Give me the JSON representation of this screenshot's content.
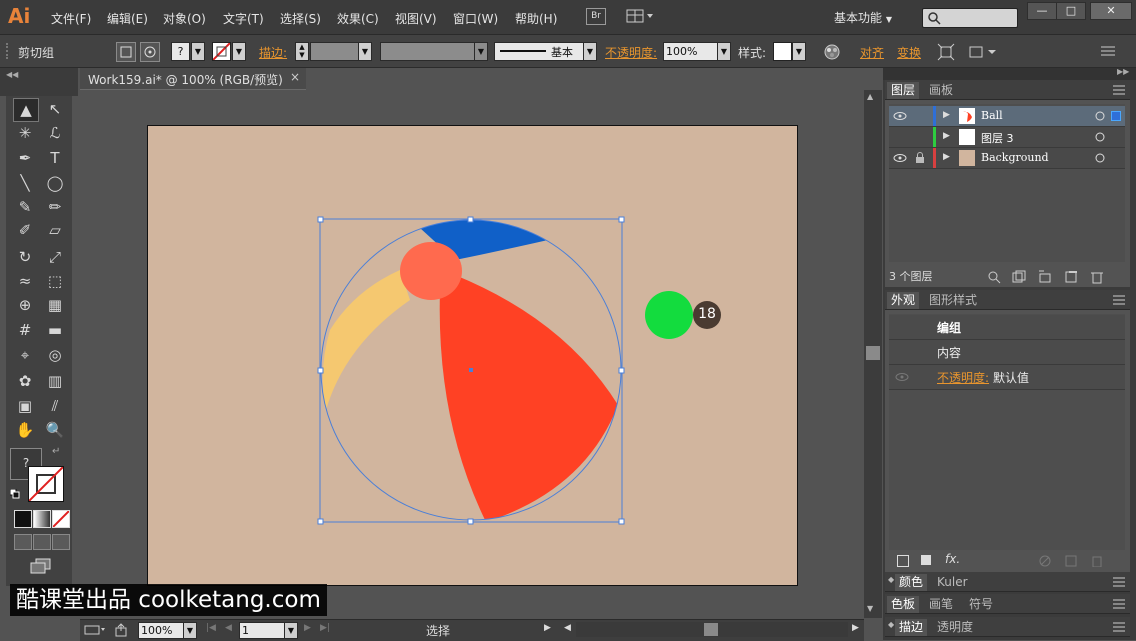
{
  "app": {
    "logo": "Ai",
    "workspace": "基本功能",
    "bridge": "Br"
  },
  "menu": [
    "文件(F)",
    "编辑(E)",
    "对象(O)",
    "文字(T)",
    "选择(S)",
    "效果(C)",
    "视图(V)",
    "窗口(W)",
    "帮助(H)"
  ],
  "window_buttons": [
    "—",
    "□",
    "✕"
  ],
  "control_bar": {
    "selection_label": "剪切组",
    "fill_state": "?",
    "stroke_label": "描边:",
    "stroke_profile": "基本",
    "opacity_label": "不透明度:",
    "opacity_value": "100%",
    "style_label": "样式:",
    "align_label": "对齐",
    "transform_label": "变换"
  },
  "document": {
    "tab_title": "Work159.ai* @ 100% (RGB/预览)",
    "close": "×"
  },
  "tools": [
    [
      "selection-tool",
      "▲"
    ],
    [
      "direct-selection-tool",
      "↖"
    ],
    [
      "magic-wand-tool",
      "✳"
    ],
    [
      "lasso-tool",
      "ℒ"
    ],
    [
      "pen-tool",
      "✒"
    ],
    [
      "type-tool",
      "T"
    ],
    [
      "line-tool",
      "╲"
    ],
    [
      "ellipse-tool",
      "◯"
    ],
    [
      "paintbrush-tool",
      "✎"
    ],
    [
      "pencil-tool",
      "✏"
    ],
    [
      "blob-brush-tool",
      "✐"
    ],
    [
      "eraser-tool",
      "▱"
    ],
    [
      "rotate-tool",
      "↻"
    ],
    [
      "scale-tool",
      "⤢"
    ],
    [
      "warp-tool",
      "≈"
    ],
    [
      "free-transform-tool",
      "⬚"
    ],
    [
      "shape-builder-tool",
      "⊕"
    ],
    [
      "perspective-grid-tool",
      "▦"
    ],
    [
      "mesh-tool",
      "#"
    ],
    [
      "gradient-tool",
      "▬"
    ],
    [
      "eyedropper-tool",
      "⌖"
    ],
    [
      "blend-tool",
      "◎"
    ],
    [
      "symbol-sprayer-tool",
      "✿"
    ],
    [
      "column-graph-tool",
      "▥"
    ],
    [
      "artboard-tool",
      "▣"
    ],
    [
      "slice-tool",
      "⫽"
    ],
    [
      "hand-tool",
      "✋"
    ],
    [
      "zoom-tool",
      "🔍"
    ]
  ],
  "toolbox": {
    "fill_indicator": "?"
  },
  "layers_panel": {
    "tabs": [
      "图层",
      "画板"
    ],
    "layers": [
      {
        "name": "Ball",
        "color": "#2e6fd8",
        "visible": true,
        "locked": false,
        "thumb": "ball",
        "selected": true
      },
      {
        "name": "图层 3",
        "color": "#2ecc40",
        "visible": false,
        "locked": false,
        "thumb": "white",
        "selected": false
      },
      {
        "name": "Background",
        "color": "#d84040",
        "visible": true,
        "locked": true,
        "thumb": "tan",
        "selected": false
      }
    ],
    "count": "3 个图层"
  },
  "appearance_panel": {
    "tabs": [
      "外观",
      "图形样式"
    ],
    "group_label": "编组",
    "content_label": "内容",
    "opacity_label": "不透明度:",
    "opacity_value": "默认值"
  },
  "collapsed_panels": [
    {
      "tabs": [
        "颜色",
        "Kuler"
      ]
    },
    {
      "tabs": [
        "色板",
        "画笔",
        "符号"
      ]
    },
    {
      "tabs": [
        "描边",
        "透明度"
      ]
    }
  ],
  "status_bar": {
    "zoom": "100%",
    "page": "1",
    "tool": "选择"
  },
  "badge": {
    "number": "18"
  },
  "watermark": "酷课堂出品 coolketang.com",
  "colors": {
    "ball_red": "#ff4124",
    "ball_yellow": "#f5c870",
    "ball_blue": "#1060c8",
    "ball_cap": "#ff6a4e",
    "green_dot": "#13dc3e",
    "artboard": "#d1b59e",
    "selection": "#4a7fd8"
  }
}
